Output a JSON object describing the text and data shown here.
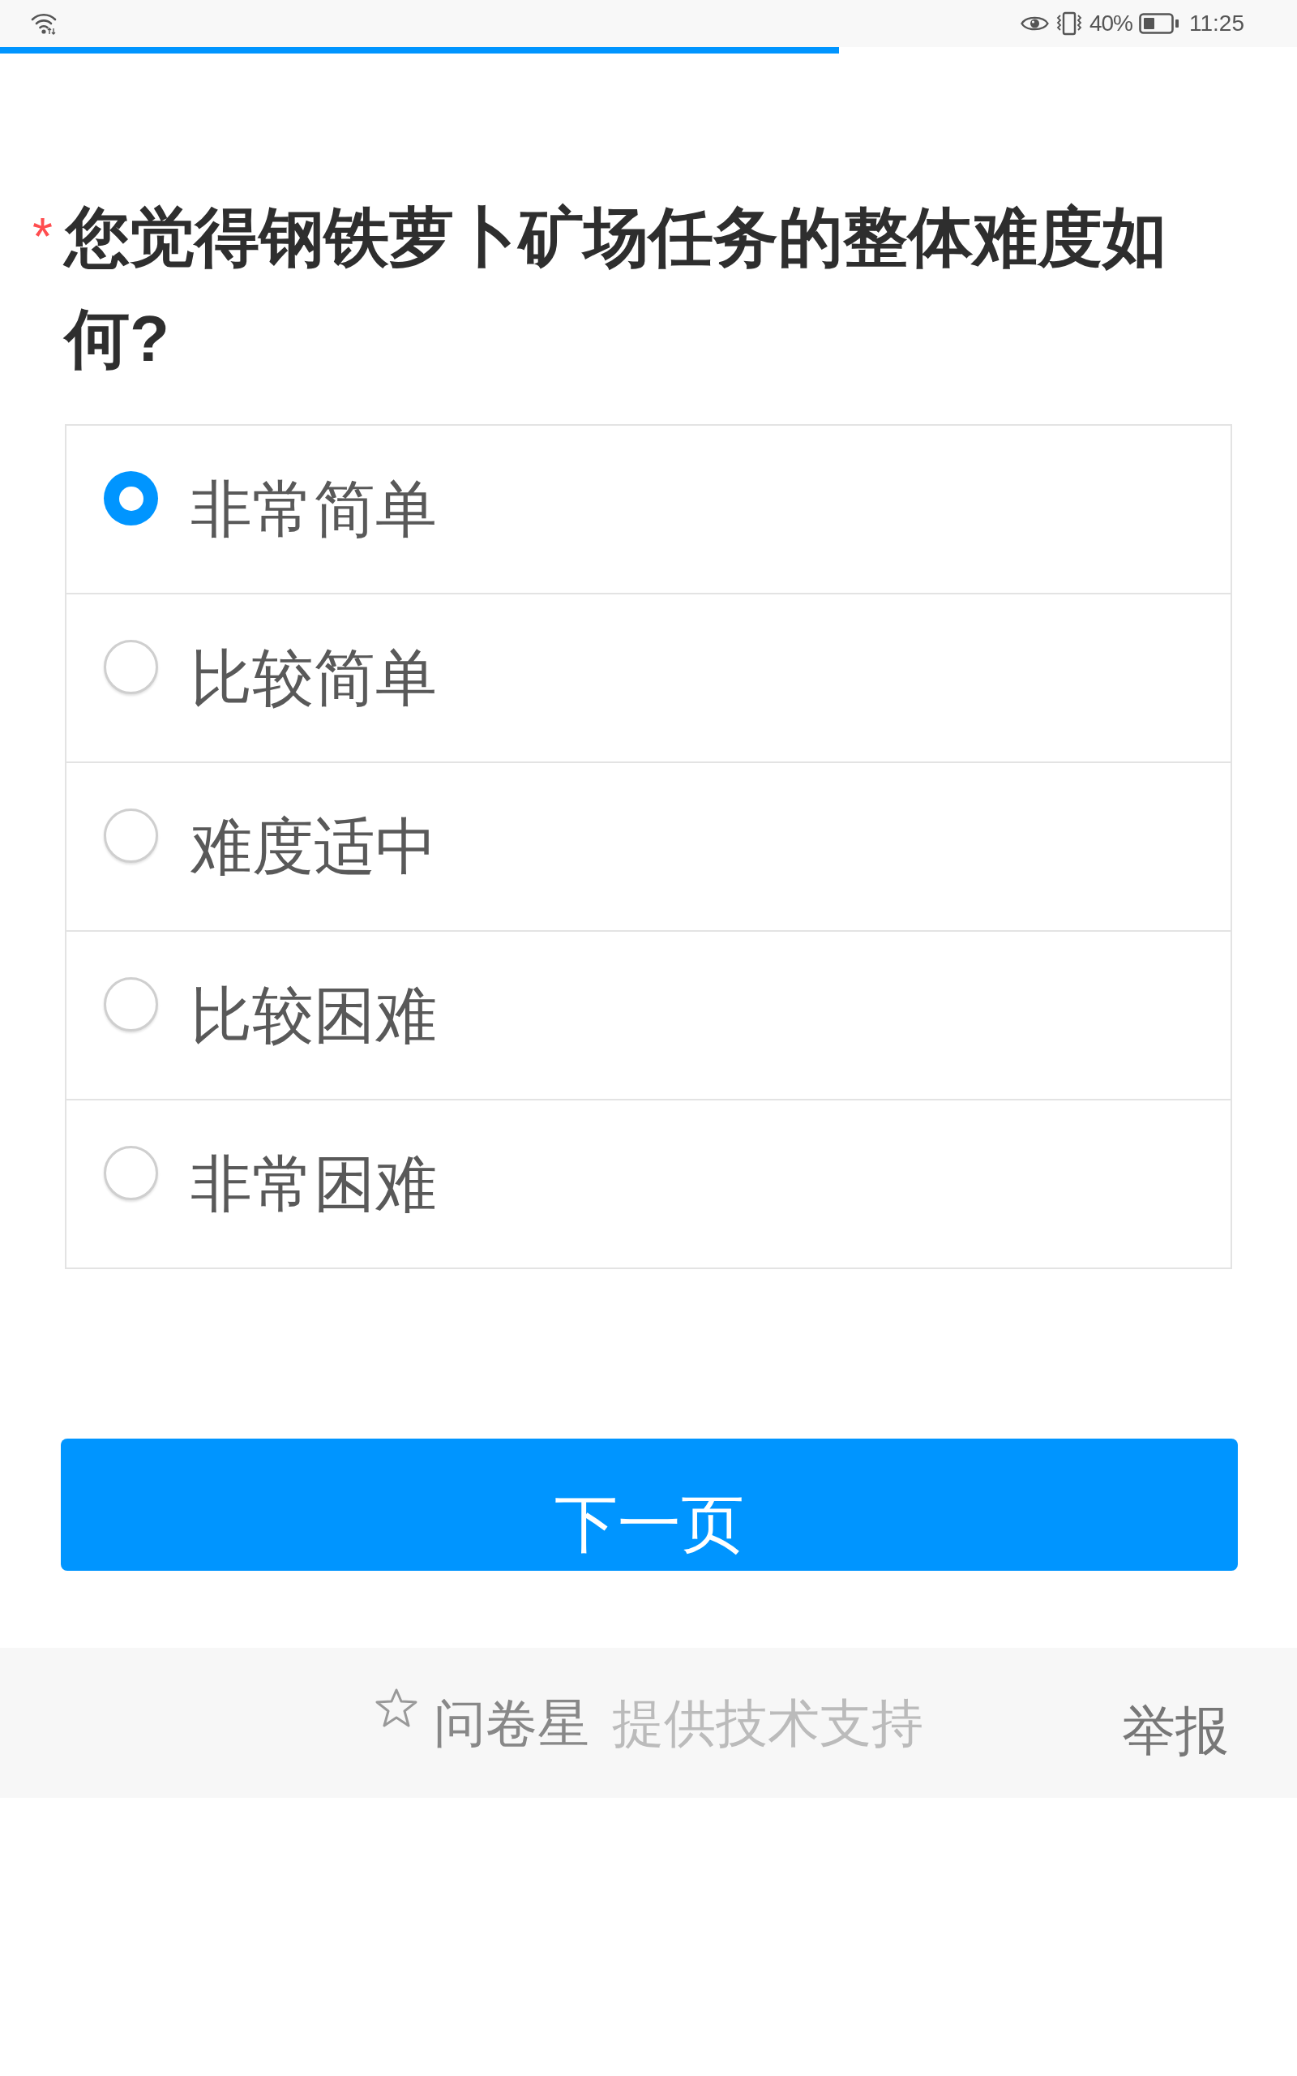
{
  "status_bar": {
    "battery": "40%",
    "time": "11:25"
  },
  "progress": {
    "level": 0.647
  },
  "question": {
    "required_mark": "*",
    "text": "您觉得钢铁萝卜矿场任务的整体难度如何?"
  },
  "options": [
    {
      "label": "非常简单",
      "selected": true
    },
    {
      "label": "比较简单",
      "selected": false
    },
    {
      "label": "难度适中",
      "selected": false
    },
    {
      "label": "比较困难",
      "selected": false
    },
    {
      "label": "非常困难",
      "selected": false
    }
  ],
  "next_button": {
    "label": "下一页"
  },
  "footer": {
    "brand": "问卷星",
    "credit": "提供技术支持",
    "report_link": "举报"
  }
}
